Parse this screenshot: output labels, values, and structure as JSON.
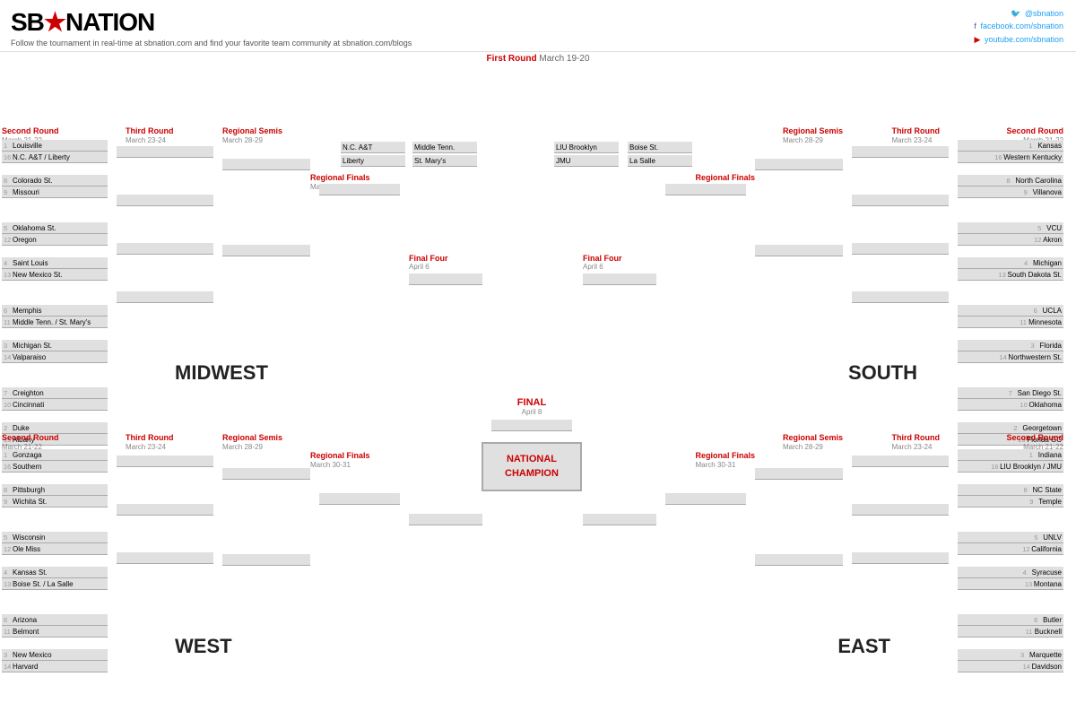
{
  "header": {
    "logo": "SB★NATION",
    "tagline": "Follow the tournament in real-time at sbnation.com and find your favorite team community at sbnation.com/blogs",
    "social": {
      "twitter": "@sbnation",
      "facebook": "facebook.com/sbnation",
      "youtube": "youtube.com/sbnation"
    }
  },
  "first_round_header": "First Round",
  "first_round_dates": "March 19-20",
  "playin": {
    "top_left": [
      {
        "seed": "",
        "name": "N.C. A&T"
      },
      {
        "seed": "",
        "name": "Liberty"
      }
    ],
    "top_right1": [
      {
        "seed": "",
        "name": "Middle Tenn."
      },
      {
        "seed": "",
        "name": "St. Mary's"
      }
    ],
    "top_right2": [
      {
        "seed": "",
        "name": "LIU Brooklyn"
      },
      {
        "seed": "",
        "name": "JMU"
      }
    ],
    "top_right3": [
      {
        "seed": "",
        "name": "Boise St."
      },
      {
        "seed": "",
        "name": "La Salle"
      }
    ]
  },
  "midwest": {
    "name": "MIDWEST",
    "rounds": {
      "r2": {
        "label": "Second Round",
        "dates": "March 21-22"
      },
      "r3": {
        "label": "Third Round",
        "dates": "March 23-24"
      },
      "semis": {
        "label": "Regional Semis",
        "dates": "March 28-29"
      },
      "finals": {
        "label": "Regional Finals",
        "dates": "March 30-31"
      }
    },
    "teams": [
      {
        "seed": "1",
        "name": "Louisville"
      },
      {
        "seed": "16",
        "name": "N.C. A&T / Liberty"
      },
      {
        "seed": "8",
        "name": "Colorado St."
      },
      {
        "seed": "9",
        "name": "Missouri"
      },
      {
        "seed": "5",
        "name": "Oklahoma St."
      },
      {
        "seed": "12",
        "name": "Oregon"
      },
      {
        "seed": "4",
        "name": "Saint Louis"
      },
      {
        "seed": "13",
        "name": "New Mexico St."
      },
      {
        "seed": "6",
        "name": "Memphis"
      },
      {
        "seed": "11",
        "name": "Middle Tenn. / St. Mary's"
      },
      {
        "seed": "3",
        "name": "Michigan St."
      },
      {
        "seed": "14",
        "name": "Valparaiso"
      },
      {
        "seed": "7",
        "name": "Creighton"
      },
      {
        "seed": "10",
        "name": "Cincinnati"
      },
      {
        "seed": "2",
        "name": "Duke"
      },
      {
        "seed": "15",
        "name": "Albany"
      }
    ]
  },
  "west": {
    "name": "WEST",
    "rounds": {
      "r2": {
        "label": "Second Round",
        "dates": "March 21-22"
      },
      "r3": {
        "label": "Third Round",
        "dates": "March 23-24"
      },
      "semis": {
        "label": "Regional Semis",
        "dates": "March 28-29"
      },
      "finals": {
        "label": "Regional Finals",
        "dates": "March 30-31"
      }
    },
    "teams": [
      {
        "seed": "1",
        "name": "Gonzaga"
      },
      {
        "seed": "16",
        "name": "Southern"
      },
      {
        "seed": "8",
        "name": "Pittsburgh"
      },
      {
        "seed": "9",
        "name": "Wichita St."
      },
      {
        "seed": "5",
        "name": "Wisconsin"
      },
      {
        "seed": "12",
        "name": "Ole Miss"
      },
      {
        "seed": "4",
        "name": "Kansas St."
      },
      {
        "seed": "13",
        "name": "Boise St. / La Salle"
      },
      {
        "seed": "6",
        "name": "Arizona"
      },
      {
        "seed": "11",
        "name": "Belmont"
      },
      {
        "seed": "3",
        "name": "New Mexico"
      },
      {
        "seed": "14",
        "name": "Harvard"
      }
    ]
  },
  "south": {
    "name": "SOUTH",
    "rounds": {
      "r2": {
        "label": "Second Round",
        "dates": "March 21-22"
      },
      "r3": {
        "label": "Third Round",
        "dates": "March 23-24"
      },
      "semis": {
        "label": "Regional Semis",
        "dates": "March 28-29"
      },
      "finals": {
        "label": "Regional Finals",
        "dates": "March 30-31"
      }
    },
    "teams": [
      {
        "seed": "1",
        "name": "Kansas"
      },
      {
        "seed": "16",
        "name": "Western Kentucky"
      },
      {
        "seed": "8",
        "name": "North Carolina"
      },
      {
        "seed": "9",
        "name": "Villanova"
      },
      {
        "seed": "5",
        "name": "VCU"
      },
      {
        "seed": "12",
        "name": "Akron"
      },
      {
        "seed": "4",
        "name": "Michigan"
      },
      {
        "seed": "13",
        "name": "South Dakota St."
      },
      {
        "seed": "6",
        "name": "UCLA"
      },
      {
        "seed": "11",
        "name": "Minnesota"
      },
      {
        "seed": "3",
        "name": "Florida"
      },
      {
        "seed": "14",
        "name": "Northwestern St."
      },
      {
        "seed": "7",
        "name": "San Diego St."
      },
      {
        "seed": "10",
        "name": "Oklahoma"
      },
      {
        "seed": "2",
        "name": "Georgetown"
      },
      {
        "seed": "15",
        "name": "Florida GC"
      }
    ]
  },
  "east": {
    "name": "EAST",
    "rounds": {
      "r2": {
        "label": "Second Round",
        "dates": "March 21-22"
      },
      "r3": {
        "label": "Third Round",
        "dates": "March 23-24"
      },
      "semis": {
        "label": "Regional Semis",
        "dates": "March 28-29"
      },
      "finals": {
        "label": "Regional Finals",
        "dates": "March 30-31"
      }
    },
    "teams": [
      {
        "seed": "1",
        "name": "Indiana"
      },
      {
        "seed": "16",
        "name": "LIU Brooklyn / JMU"
      },
      {
        "seed": "8",
        "name": "NC State"
      },
      {
        "seed": "9",
        "name": "Temple"
      },
      {
        "seed": "5",
        "name": "UNLV"
      },
      {
        "seed": "12",
        "name": "California"
      },
      {
        "seed": "4",
        "name": "Syracuse"
      },
      {
        "seed": "13",
        "name": "Montana"
      },
      {
        "seed": "6",
        "name": "Butler"
      },
      {
        "seed": "11",
        "name": "Bucknell"
      },
      {
        "seed": "3",
        "name": "Marquette"
      },
      {
        "seed": "14",
        "name": "Davidson"
      }
    ]
  },
  "final_four": {
    "label": "Final Four",
    "date": "April 6"
  },
  "final": {
    "label": "FINAL",
    "date": "April 8"
  },
  "national_champion": {
    "label": "NATIONAL CHAMPION"
  }
}
